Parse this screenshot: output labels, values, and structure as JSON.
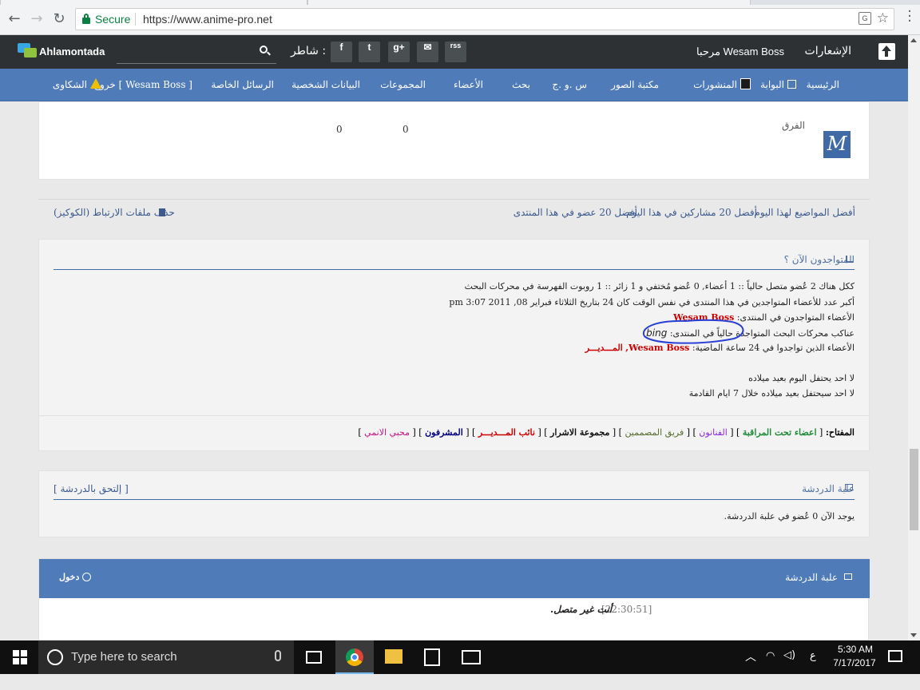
{
  "browser": {
    "secure_label": "Secure",
    "url": "https://www.anime-pro.net"
  },
  "topbar": {
    "logo_text": "Ahlamontada",
    "shater_label": "شاطر :",
    "social": [
      "f",
      "t",
      "g+",
      "✉",
      "rss"
    ],
    "welcome": "مرحبا Wesam Boss",
    "notifications": "الإشعارات"
  },
  "nav": {
    "items": [
      "الرئيسية",
      "البوابة",
      "المنشورات",
      "مكتبة الصور",
      "س .و .ج",
      "بحث",
      "الأعضاء",
      "المجموعات",
      "البيانات الشخصية",
      "الرسائل الخاصة",
      "خروج [ Wesam Boss ]",
      "الشكاوى"
    ]
  },
  "groups": {
    "label": "الفرق",
    "val1": "0",
    "val2": "0"
  },
  "links": {
    "top_topics": "أفضل المواضيع لهذا اليوم",
    "top20_today": "أفضل 20 مشاركين في هذا اليوم",
    "top20_forum": "أفضل 20 عضو في هذا المنتدى",
    "delete_cookies": "حذف ملفات الارتباط (الكوكيز)"
  },
  "online": {
    "title": "المتواجدون الآن ؟",
    "line1": "ككل هناك 2 عُضو متصل حالياً :: 1 أعضاء, 0 عُضو مُختفي و 1 زائر :: 1 روبوت الفهرسة في محركات البحث",
    "line2": "أكبر عدد للأعضاء المتواجدين في هذا المنتدى في نفس الوقت كان 24 بتاريخ الثلاثاء فبراير 08, 2011 3:07 pm",
    "line3_label": "الأعضاء المتواجدون في المنتدى:",
    "line3_user": "Wesam Boss",
    "line4_label": "عناكب محركات البحث المتواجدة حالياً في المنتدى:",
    "line4_bot": "bing",
    "line5_label": "الأعضاء الذين تواجدوا في 24 ساعة الماضية:",
    "line5_user1": "Wesam Boss,",
    "line5_user2": "المـــديـــر",
    "birthday_today": "لا احد يحتفل اليوم بعيد ميلاده",
    "birthday_week": "لا احد سيحتفل بعيد ميلاده خلال 7 ايام القادمة"
  },
  "legend": {
    "label": "المفتاح:",
    "items": [
      {
        "name": "اعضاء تحت المراقبة",
        "color": "#1f8a3a"
      },
      {
        "name": "الفنانون",
        "color": "#8a2be2"
      },
      {
        "name": "فريق المصممين",
        "color": "#556b2f"
      },
      {
        "name": "مجموعة الاشرار",
        "color": "#111111"
      },
      {
        "name": "نائب المـــديـــر",
        "color": "#cc0000"
      },
      {
        "name": "المشرفون",
        "color": "#000080"
      },
      {
        "name": "محبي الانمي",
        "color": "#c71585"
      }
    ]
  },
  "chatbox": {
    "title": "علبة الدردشة",
    "join": "[ إلتحق بالدردشة ]",
    "count_text": "يوجد الآن 0 عُضو في علبة الدردشة."
  },
  "chat": {
    "title": "علبة الدردشة",
    "login": "دخول",
    "time": "[22:30:51]",
    "message": "أنت غير متصل."
  },
  "taskbar": {
    "search_placeholder": "Type here to search",
    "lang": "ع",
    "time": "5:30 AM",
    "date": "7/17/2017"
  }
}
